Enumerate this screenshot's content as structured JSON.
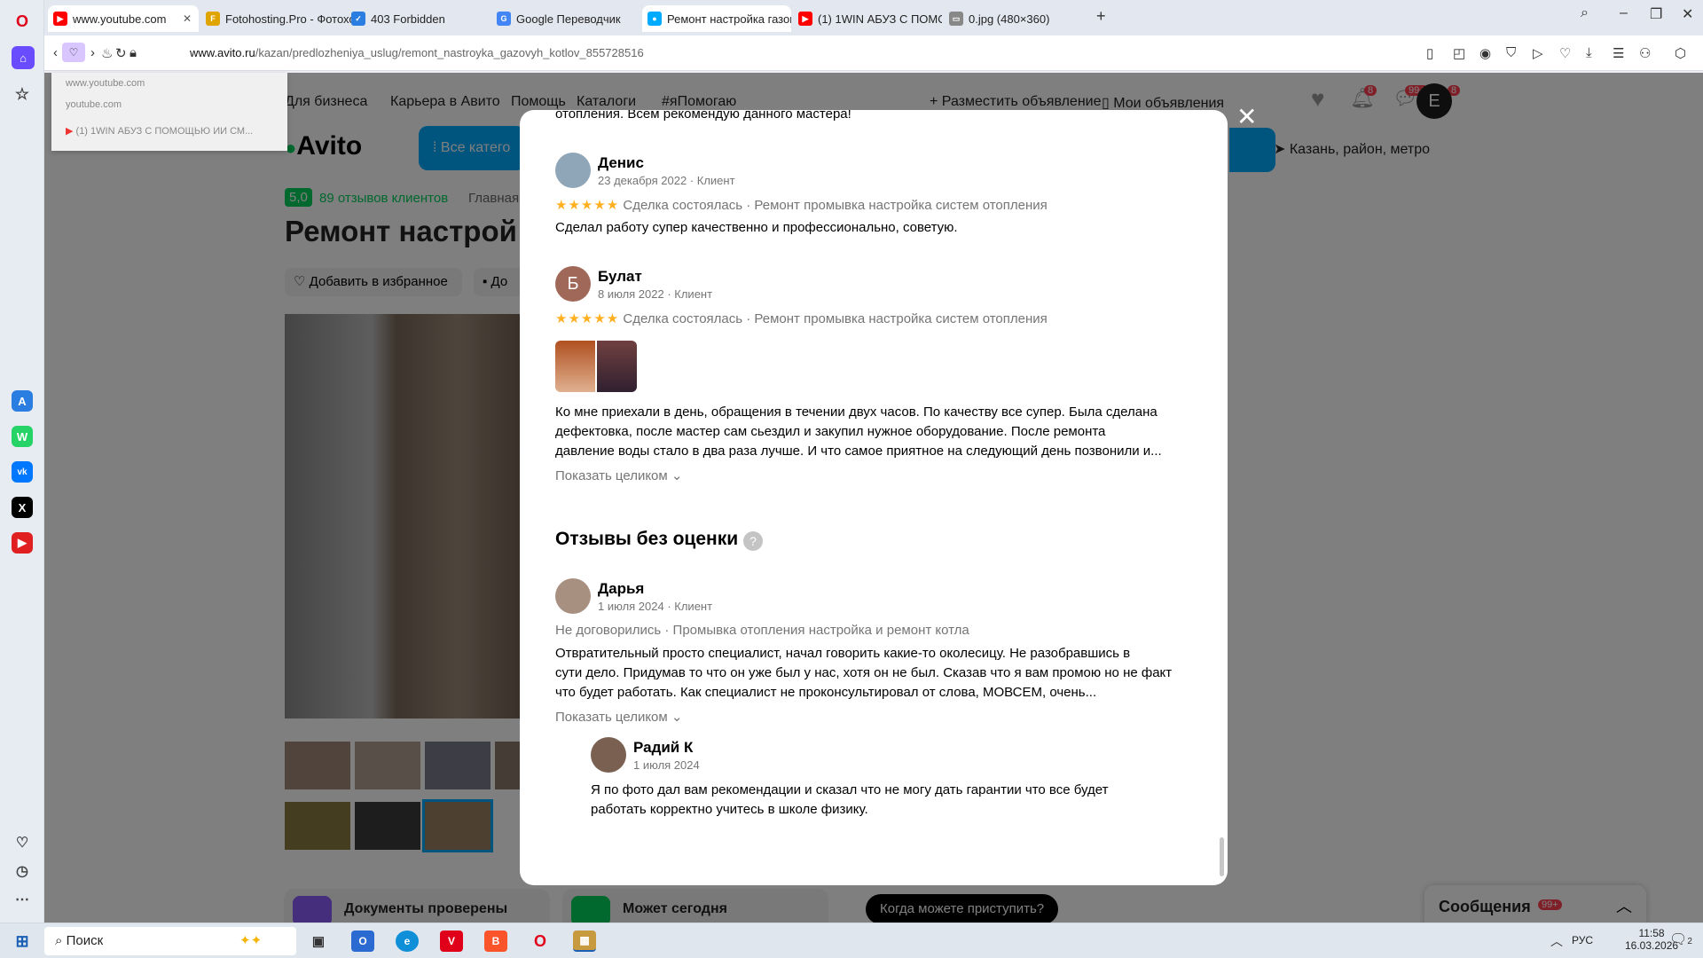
{
  "browser": {
    "tabs": [
      {
        "label": "www.youtube.com",
        "color": "#ff0000"
      },
      {
        "label": "Fotohosting.Pro - Фотохо",
        "color": "#e0a400"
      },
      {
        "label": "403 Forbidden",
        "color": "#2a7de1"
      },
      {
        "label": "Google Переводчик",
        "color": "#4285f4"
      },
      {
        "label": "Ремонт настройка газов",
        "color": "#00aaff"
      },
      {
        "label": "(1) 1WIN АБУЗ С ПОМОЩ",
        "color": "#ff0000"
      },
      {
        "label": "0.jpg (480×360)",
        "color": "#888888"
      }
    ],
    "url_host": "www.avito.ru",
    "url_path": "/kazan/predlozheniya_uslug/remont_nastroyka_gazovyh_kotlov_855728516",
    "history_dropdown": [
      "www.youtube.com",
      "youtube.com",
      "(1) 1WIN АБУЗ С ПОМОЩЬЮ ИИ СМ..."
    ]
  },
  "avito": {
    "nav": [
      "Для бизнеса",
      "Карьера в Авито",
      "Помощь",
      "Каталоги",
      "#яПомогаю"
    ],
    "post_ad": "Разместить объявление",
    "my_ads": "Мои объявления",
    "badges": {
      "notifications": "8",
      "messages": "99+",
      "cart": "8"
    },
    "avatar_letter": "E",
    "logo": "Avito",
    "all_categories": "Все катего",
    "location": "Казань, район, метро",
    "rating": "5,0",
    "reviews_link": "89 отзывов клиентов",
    "crumb": "Главная",
    "title": "Ремонт настрой",
    "fav_button": "Добавить в избранное",
    "fav2_button": "До",
    "docs_card": "Документы проверены",
    "today_card": "Может сегодня",
    "when_button": "Когда можете приступить?",
    "messages_panel": "Сообщения",
    "messages_badge": "99+"
  },
  "modal": {
    "top_text": "отопления. Всем рекомендую данного мастера!",
    "reviews": [
      {
        "name": "Денис",
        "meta": "23 декабря 2022 · Клиент",
        "status": "Сделка состоялась · Ремонт промывка настройка систем отопления",
        "text": "Сделал работу супер качественно и профессионально, советую."
      },
      {
        "name": "Булат",
        "initial": "Б",
        "meta": "8 июля 2022 · Клиент",
        "status": "Сделка состоялась · Ремонт промывка настройка систем отопления",
        "text1": "Ко мне приехали в день, обращения в течении двух часов. По качеству все супер. Была сделана",
        "text2": "дефектовка, после мастер сам сьездил и закупил нужное оборудование. После ремонта",
        "text3": "давление воды стало в два раза лучше. И что самое приятное на следующий день позвонили и...",
        "more": "Показать целиком"
      }
    ],
    "no_rating_heading": "Отзывы без оценки",
    "help_glyph": "?",
    "darya": {
      "name": "Дарья",
      "meta": "1 июля 2024 · Клиент",
      "status": "Не договорились · Промывка отопления настройка и ремонт котла",
      "text1": "Отвратительный просто специалист, начал говорить какие-то околесицу. Не разобравшись в",
      "text2": "сути дело. Придумав то что он уже был у нас, хотя он не был. Сказав что я вам промою но не факт",
      "text3": "что будет работать. Как специалист не проконсультировал от слова, МОВСЕМ, очень...",
      "more": "Показать целиком"
    },
    "reply": {
      "name": "Радий К",
      "meta": "1 июля 2024",
      "text1": "Я по фото дал вам рекомендации и сказал что не могу дать гарантии что все будет",
      "text2": "работать корректно учитесь в школе физику."
    }
  },
  "taskbar": {
    "search": "Поиск",
    "lang": "РУС",
    "time": "11:58",
    "date": "16.03.2026",
    "notif_count": "2"
  },
  "colors": {
    "avito_blue": "#00aaff",
    "star": "#ffb021",
    "green": "#02d15c"
  }
}
